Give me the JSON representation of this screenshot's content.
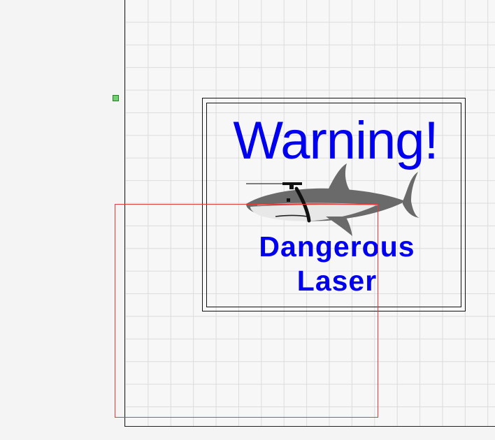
{
  "sign": {
    "title": "Warning!",
    "line1": "Dangerous",
    "line2": "Laser"
  },
  "colors": {
    "text": "#0000ee",
    "grid": "#dcdcdc",
    "selection": "#e53b3b",
    "handle": "#6fd16f"
  },
  "icons": {
    "shark": "shark-with-laser-icon"
  }
}
